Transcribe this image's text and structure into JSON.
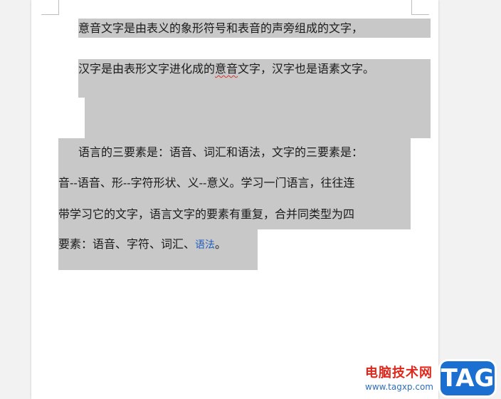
{
  "document": {
    "para1": {
      "line1": "意音文字是由表义的象形符号和表音的声旁组成的文字，",
      "line2_before": "汉字是由表形文字进化成的",
      "line2_squiggle": "意音",
      "line2_after": "文字，汉字也是语素文字。"
    },
    "para2": {
      "line1": "语言的三要素是：语音、词汇和语法，文字的三要素是：",
      "line2": "音--语音、形--字符形状、义--意义。学习一门语言，往往连",
      "line3": "带学习它的文字，语言文字的要素有重复，合并同类型为四",
      "line4_before": "要素：语音、字符、词汇、",
      "line4_link": "语法",
      "line4_after": "。"
    }
  },
  "watermark": {
    "site_name": "电脑技术网",
    "url": "www.tagxp.com",
    "tag": "TAG"
  },
  "colors": {
    "selection": "#c8c8c8",
    "page": "#ffffff",
    "watermark_red": "#e0271c",
    "tag_blue": "#1b6fd0"
  }
}
